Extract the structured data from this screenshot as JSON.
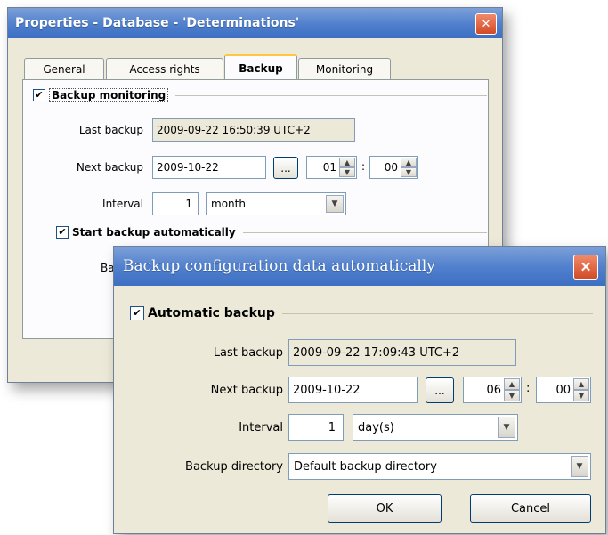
{
  "properties": {
    "title": "Properties - Database - 'Determinations'",
    "close_glyph": "✕",
    "tabs": [
      {
        "label": "General",
        "active": false
      },
      {
        "label": "Access rights",
        "active": false
      },
      {
        "label": "Backup",
        "active": true
      },
      {
        "label": "Monitoring",
        "active": false
      }
    ],
    "backup_monitoring": {
      "label": "Backup monitoring",
      "checked": true
    },
    "last_backup_label": "Last backup",
    "last_backup_value": "2009-09-22 16:50:39 UTC+2",
    "next_backup_label": "Next backup",
    "next_backup_date": "2009-10-22",
    "browse_label": "...",
    "hour": "01",
    "colon": ":",
    "minute": "00",
    "interval_label": "Interval",
    "interval_value": "1",
    "interval_unit": "month",
    "start_auto": {
      "label": "Start backup automatically",
      "checked": true
    },
    "partial_label": "Ba"
  },
  "backup_dialog": {
    "title": "Backup configuration data automatically",
    "close_glyph": "✕",
    "automatic_backup": {
      "label": "Automatic backup",
      "checked": true
    },
    "last_backup_label": "Last backup",
    "last_backup_value": "2009-09-22 17:09:43 UTC+2",
    "next_backup_label": "Next backup",
    "next_backup_date": "2009-10-22",
    "browse_label": "...",
    "hour": "06",
    "colon": ":",
    "minute": "00",
    "interval_label": "Interval",
    "interval_value": "1",
    "interval_unit": "day(s)",
    "directory_label": "Backup directory",
    "directory_value": "Default backup directory",
    "ok_label": "OK",
    "cancel_label": "Cancel"
  },
  "icons": {
    "check": "✔",
    "up": "▲",
    "down": "▼",
    "dropdown": "▼"
  },
  "colors": {
    "title_bar": "#4f7fcd",
    "close_button": "#d24a26",
    "dialog_bg": "#ece9d8",
    "tab_highlight": "#ffc83c"
  }
}
